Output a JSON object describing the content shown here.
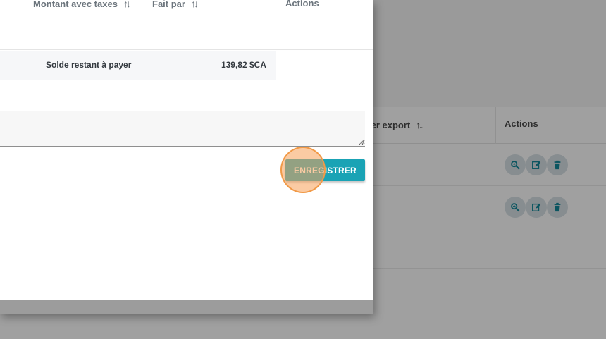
{
  "background": {
    "columns": {
      "export": "ier export",
      "actions": "Actions"
    },
    "rows": [
      {
        "actions": [
          "search-icon",
          "edit-icon",
          "trash-icon"
        ]
      },
      {
        "actions": [
          "search-icon",
          "edit-icon",
          "trash-icon"
        ]
      }
    ]
  },
  "modal": {
    "table": {
      "columns": {
        "amount_with_taxes": "Montant avec taxes",
        "done_by": "Fait par",
        "actions": "Actions"
      },
      "total_label": "Solde restant à payer",
      "total_value": "139,82 $CA"
    },
    "notes": {
      "value": "",
      "placeholder": ""
    },
    "save_label": "ENREGISTRER"
  },
  "colors": {
    "primary": "#1aa3b5",
    "click_marker": "#f19a48"
  }
}
